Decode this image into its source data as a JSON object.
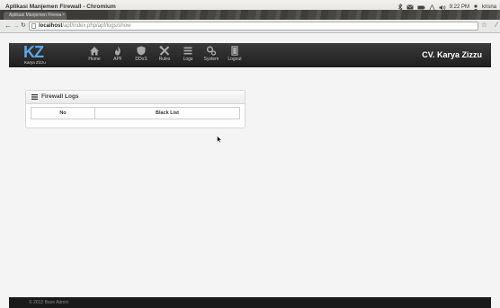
{
  "window": {
    "title": "Aplikasi Manjemen Firewall - Chromium",
    "tray_time": "9:22 PM",
    "tray_user": "krisna"
  },
  "browser": {
    "tab_label": "Aplikasi Manjemen Firewa",
    "url_host": "localhost",
    "url_path": "/apf/index.php/apf/logs/show"
  },
  "app": {
    "logo_text": "KZ",
    "logo_subtext": "Karya Zizzu",
    "brand": "CV. Karya Zizzu",
    "nav": [
      {
        "label": "Home",
        "icon": "home-icon"
      },
      {
        "label": "APF",
        "icon": "flame-icon"
      },
      {
        "label": "DDoS",
        "icon": "shield-icon"
      },
      {
        "label": "Rules",
        "icon": "tools-icon"
      },
      {
        "label": "Logs",
        "icon": "list-icon"
      },
      {
        "label": "System",
        "icon": "gears-icon"
      },
      {
        "label": "Logout",
        "icon": "exit-icon"
      }
    ]
  },
  "panel": {
    "title": "Firewall Logs",
    "columns": [
      "No",
      "Black List"
    ]
  },
  "footer": {
    "text": "© 2012 Base Admin"
  },
  "colors": {
    "header_bg": "#2b2b2b",
    "logo_accent": "#5aa7e8",
    "page_bg": "#f4f4f4"
  }
}
